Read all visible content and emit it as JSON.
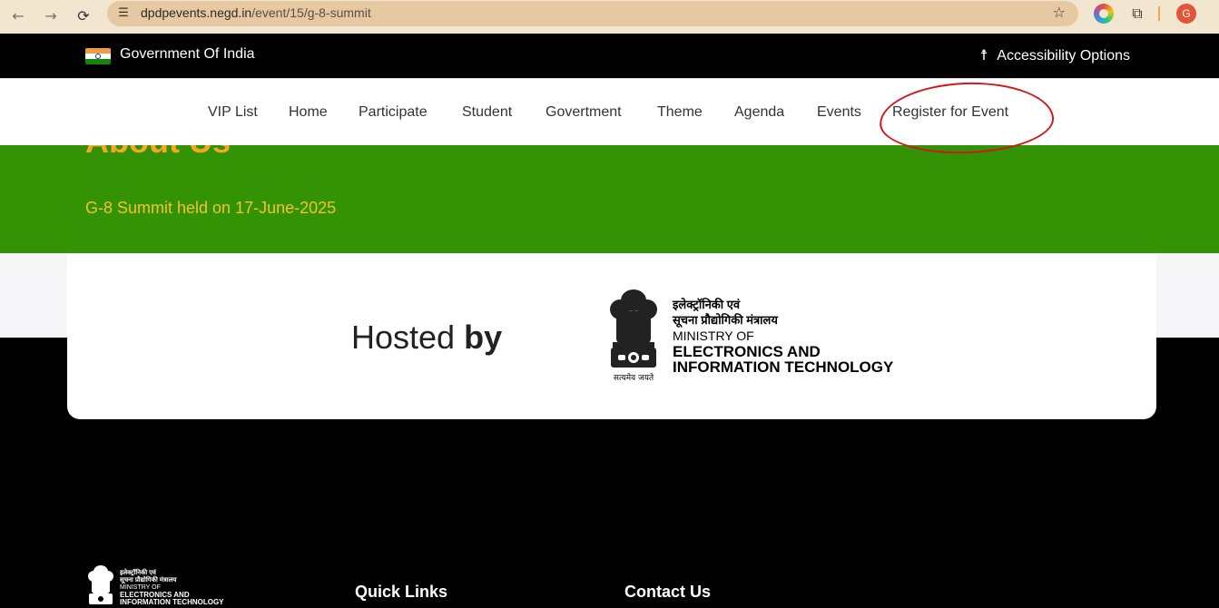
{
  "browser": {
    "url_host": "dpdpevents.negd.in",
    "url_path": "/event/15/g-8-summit",
    "profile_initial": "G"
  },
  "govbar": {
    "title": "Government Of India",
    "accessibility_label": "Accessibility Options"
  },
  "nav": {
    "items": [
      {
        "label": "VIP List"
      },
      {
        "label": "Home"
      },
      {
        "label": "Participate"
      },
      {
        "label": "Student"
      },
      {
        "label": "Govertment"
      },
      {
        "label": "Theme"
      },
      {
        "label": "Agenda"
      },
      {
        "label": "Events"
      },
      {
        "label": "Register for Event"
      }
    ]
  },
  "hero": {
    "heading": "About Us",
    "subtitle": "G-8 Summit held on 17-June-2025"
  },
  "hosted": {
    "prefix": "Hosted ",
    "bold": "by",
    "ministry_hindi_1": "इलेक्ट्रॉनिकी एवं",
    "ministry_hindi_2": "सूचना प्रौद्योगिकी मंत्रालय",
    "ministry_line1": "MINISTRY OF",
    "ministry_line2": "ELECTRONICS AND",
    "ministry_line3": "INFORMATION TECHNOLOGY",
    "emblem_motto": "सत्यमेव जयते"
  },
  "footer": {
    "quick_links": "Quick Links",
    "contact_us": "Contact Us"
  },
  "colors": {
    "hero_green": "#339304",
    "accent_orange": "#f5a623",
    "annotation_red": "#d0171c"
  }
}
